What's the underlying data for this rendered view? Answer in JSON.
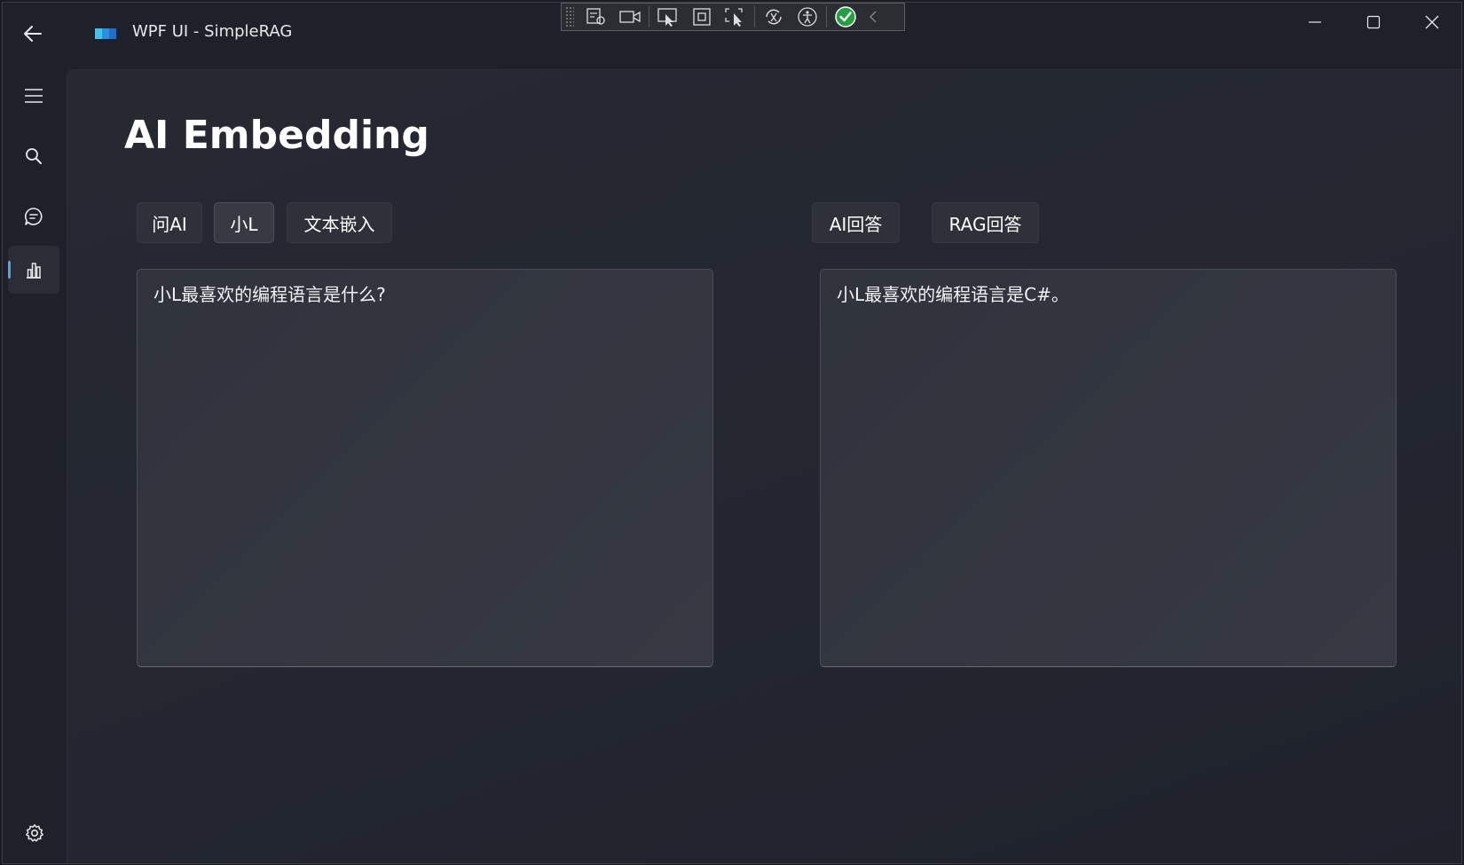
{
  "window": {
    "title": "WPF UI - SimpleRAG"
  },
  "nav": {
    "items": [
      {
        "name": "menu",
        "icon": "hamburger-menu-icon"
      },
      {
        "name": "search",
        "icon": "search-icon"
      },
      {
        "name": "chat",
        "icon": "chat-bubble-icon"
      },
      {
        "name": "embedding",
        "icon": "bar-chart-icon",
        "active": true
      }
    ],
    "footer_icon": "settings-gear-icon"
  },
  "page": {
    "title": "AI Embedding",
    "left_buttons": [
      "问AI",
      "小L",
      "文本嵌入"
    ],
    "right_buttons": [
      "AI回答",
      "RAG回答"
    ],
    "question_text": "小L最喜欢的编程语言是什么?",
    "answer_text": "小L最喜欢的编程语言是C#。"
  },
  "debug_toolbar": {
    "icons": [
      "go-to-live-visual-tree-icon",
      "record-icon",
      "select-element-icon",
      "display-layout-adorners-icon",
      "track-focus-icon",
      "hot-reload-icon",
      "accessibility-icon",
      "binding-ok-icon",
      "collapse-icon"
    ]
  },
  "colors": {
    "accent": "#4fa3e0",
    "background": "#1e2129",
    "content": "#252831",
    "check": "#22a041"
  }
}
